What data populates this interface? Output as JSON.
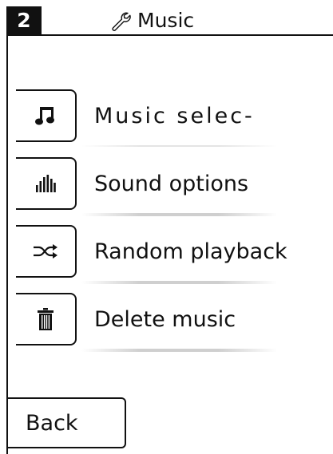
{
  "header": {
    "page_number": "2",
    "title": "Music",
    "title_icon": "wrench-icon"
  },
  "menu": {
    "items": [
      {
        "label": "Music  selec-",
        "icon": "music-note-icon"
      },
      {
        "label": "Sound options",
        "icon": "equalizer-icon"
      },
      {
        "label": "Random playback",
        "icon": "shuffle-icon"
      },
      {
        "label": "Delete music",
        "icon": "trash-icon"
      }
    ]
  },
  "footer": {
    "back_label": "Back"
  }
}
